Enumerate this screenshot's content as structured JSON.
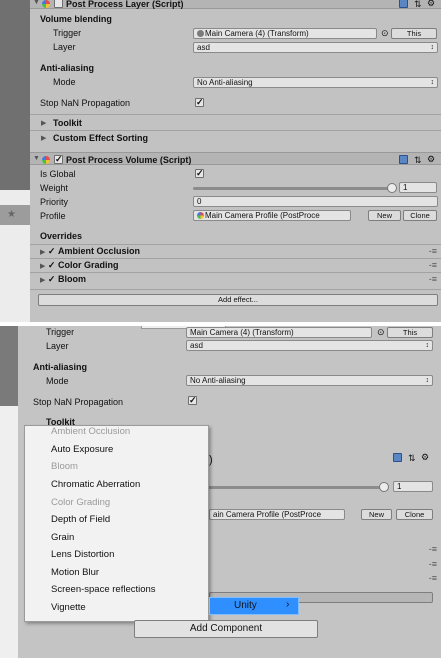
{
  "top": {
    "layer": {
      "title": "Post Process Layer (Script)",
      "section_volume_blending": "Volume blending",
      "trigger_label": "Trigger",
      "trigger_value": "Main Camera (4) (Transform)",
      "this_button": "This",
      "layer_label": "Layer",
      "layer_value": "asd",
      "section_anti_aliasing": "Anti-aliasing",
      "mode_label": "Mode",
      "mode_value": "No Anti-aliasing",
      "stop_nan_label": "Stop NaN Propagation",
      "stop_nan_checked": true,
      "toolkit_label": "Toolkit",
      "custom_effect_label": "Custom Effect Sorting"
    },
    "volume": {
      "title": "Post Process Volume (Script)",
      "is_global_label": "Is Global",
      "is_global_checked": true,
      "weight_label": "Weight",
      "weight_value": "1",
      "weight_level": 1.0,
      "priority_label": "Priority",
      "priority_value": "0",
      "profile_label": "Profile",
      "profile_value": "Main Camera Profile (PostProce",
      "new_button": "New",
      "clone_button": "Clone",
      "overrides_label": "Overrides",
      "overrides": [
        {
          "label": "Ambient Occlusion",
          "enabled": true
        },
        {
          "label": "Color Grading",
          "enabled": true
        },
        {
          "label": "Bloom",
          "enabled": true
        }
      ],
      "add_effect_button": "Add effect..."
    }
  },
  "bottom": {
    "trigger_label": "Trigger",
    "trigger_value": "Main Camera (4) (Transform)",
    "this_button": "This",
    "layer_label": "Layer",
    "layer_value": "asd",
    "section_anti_aliasing": "Anti-aliasing",
    "mode_label": "Mode",
    "mode_value": "No Anti-aliasing",
    "stop_nan_label": "Stop NaN Propagation",
    "stop_nan_checked": true,
    "toolkit_label": "Toolkit",
    "weight_value": "1",
    "profile_value": "ain Camera Profile (PostProce",
    "new_button": "New",
    "clone_button": "Clone",
    "menu_items": [
      {
        "label": "Ambient Occlusion",
        "disabled": true
      },
      {
        "label": "Auto Exposure",
        "disabled": false
      },
      {
        "label": "Bloom",
        "disabled": true
      },
      {
        "label": "Chromatic Aberration",
        "disabled": false
      },
      {
        "label": "Color Grading",
        "disabled": true
      },
      {
        "label": "Depth of Field",
        "disabled": false
      },
      {
        "label": "Grain",
        "disabled": false
      },
      {
        "label": "Lens Distortion",
        "disabled": false
      },
      {
        "label": "Motion Blur",
        "disabled": false
      },
      {
        "label": "Screen-space reflections",
        "disabled": false
      },
      {
        "label": "Vignette",
        "disabled": false
      }
    ],
    "submenu_label": "Unity",
    "add_component_button": "Add Component"
  },
  "colors": {
    "inspector_bg": "#c2c2c2",
    "highlight": "#2f8fff",
    "checkmark": "#1a1a1a"
  },
  "icons": [
    "help-icon",
    "preset-icon",
    "gear-icon",
    "checkmark-icon",
    "foldout-arrow-icon",
    "drag-handle-icon",
    "object-picker-icon"
  ]
}
